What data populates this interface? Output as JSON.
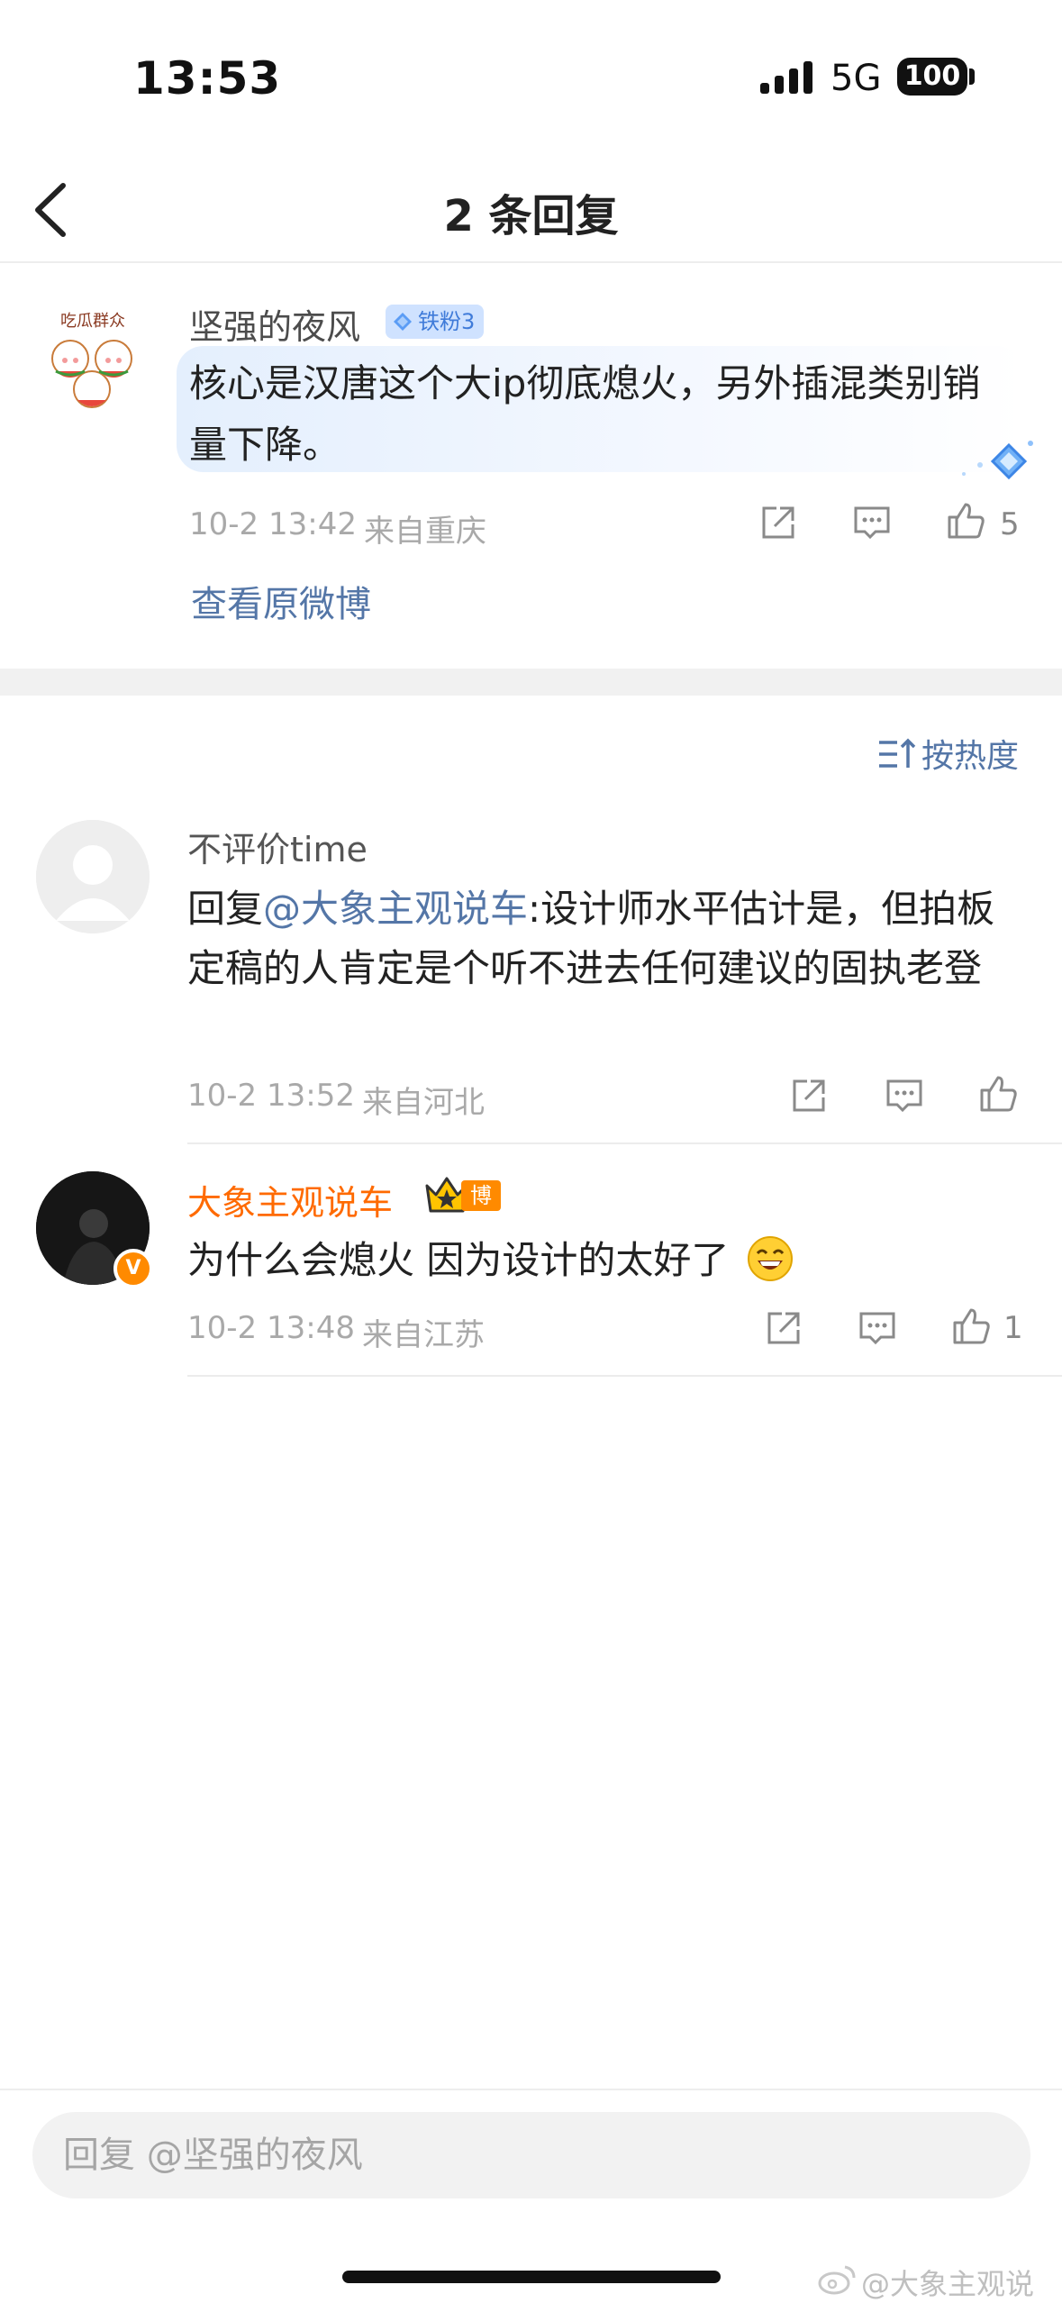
{
  "status_bar": {
    "time": "13:53",
    "network": "5G",
    "battery": "100"
  },
  "nav": {
    "title": "2 条回复"
  },
  "root_comment": {
    "username": "坚强的夜风",
    "fan_badge": "铁粉3",
    "text": "核心是汉唐这个大ip彻底熄火，另外插混类别销量下降。",
    "timestamp": "10-2 13:42",
    "location": "来自重庆",
    "likes": "5",
    "view_original": "查看原微博"
  },
  "sort": {
    "label": "按热度"
  },
  "replies": [
    {
      "username": "不评价time",
      "reply_prefix": "回复",
      "mention": "@大象主观说车",
      "text": ":设计师水平估计是，但拍板定稿的人肯定是个听不进去任何建议的固执老登",
      "timestamp": "10-2 13:52",
      "location": "来自河北"
    },
    {
      "username": "大象主观说车",
      "badge": "博主",
      "text": "为什么会熄火 因为设计的太好了",
      "timestamp": "10-2 13:48",
      "location": "来自江苏",
      "likes": "1"
    }
  ],
  "bottom": {
    "reply_placeholder": "回复 @坚强的夜风",
    "watermark": "@大象主观说车"
  },
  "colors": {
    "link": "#5476a7",
    "blogger_name": "#ff6a00",
    "badge_orange": "#ff8a00",
    "fan_badge_bg": "#cfe2ff"
  }
}
